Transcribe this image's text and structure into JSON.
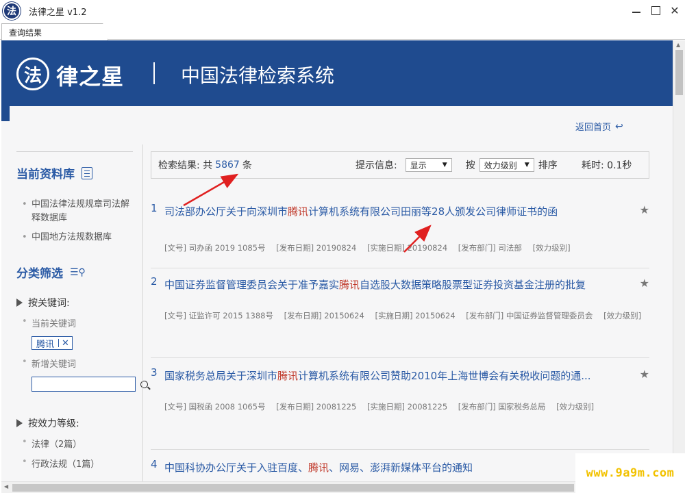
{
  "window": {
    "title": "法律之星 v1.2",
    "logo_glyph": "法"
  },
  "tab": {
    "label": "查询结果"
  },
  "banner": {
    "logo_glyph": "法",
    "brand": "律之星",
    "system_name": "中国法律检索系统"
  },
  "home_link": "返回首页",
  "sidebar": {
    "db_heading": "当前资料库",
    "databases": [
      "中国法律法规规章司法解释数据库",
      "中国地方法规数据库"
    ],
    "filter_heading": "分类筛选",
    "keyword_group": "按关键词:",
    "current_keyword_label": "当前关键词",
    "current_keyword": "腾讯",
    "new_keyword_label": "新增关键词",
    "new_keyword_value": "",
    "level_group": "按效力等级:",
    "levels": [
      "法律（2篇）",
      "行政法规（1篇）"
    ]
  },
  "summary": {
    "prefix": "检索结果:  共",
    "count": "5867",
    "suffix": "条",
    "hint_label": "提示信息:",
    "hint_value": "显示",
    "sort_prefix": "按",
    "sort_value": "效力级别",
    "sort_suffix": "排序",
    "time_label": "耗时: 0.1秒"
  },
  "results": [
    {
      "num": "1",
      "title_before": "司法部办公厅关于向深圳市",
      "highlight": "腾讯",
      "title_after": "计算机系统有限公司田丽等28人颁发公司律师证书的函",
      "meta": [
        "[文号] 司办函 2019 1085号",
        "[发布日期] 20190824",
        "[实施日期] 20190824",
        "[发布部门] 司法部",
        "[效力级别]"
      ]
    },
    {
      "num": "2",
      "title_before": "中国证券监督管理委员会关于准予嘉实",
      "highlight": "腾讯",
      "title_after": "自选股大数据策略股票型证券投资基金注册的批复",
      "meta": [
        "[文号] 证监许可 2015 1388号",
        "[发布日期] 20150624",
        "[实施日期] 20150624",
        "[发布部门] 中国证券监督管理委员会",
        "[效力级别]"
      ]
    },
    {
      "num": "3",
      "title_before": "国家税务总局关于深圳市",
      "highlight": "腾讯",
      "title_after": "计算机系统有限公司赞助2010年上海世博会有关税收问题的通...",
      "meta": [
        "[文号] 国税函 2008 1065号",
        "[发布日期] 20081225",
        "[实施日期] 20081225",
        "[发布部门] 国家税务总局",
        "[效力级别]"
      ]
    },
    {
      "num": "4",
      "title_before": "中国科协办公厅关于入驻百度、",
      "highlight": "腾讯",
      "title_after": "、网易、澎湃新媒体平台的通知",
      "meta": []
    }
  ],
  "watermark": "www.9a9m.com",
  "colors": {
    "banner": "#1f4b8f",
    "link": "#2a5aa5",
    "highlight": "#c0392b",
    "arrow": "#e02020"
  }
}
